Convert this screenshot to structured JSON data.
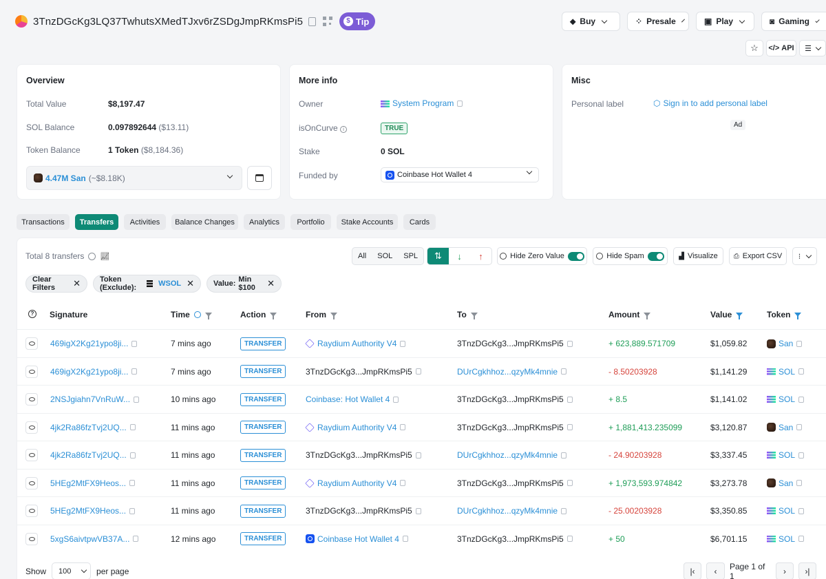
{
  "header": {
    "address": "3TnzDGcKg3LQ37TwhutsXMedTJxv6rZSDgJmpRKmsPi5",
    "tip_label": "Tip",
    "nav": [
      {
        "label": "Buy",
        "icon": "tag-icon"
      },
      {
        "label": "Presale",
        "icon": "presale-icon"
      },
      {
        "label": "Play",
        "icon": "play-icon"
      },
      {
        "label": "Gaming",
        "icon": "gamepad-icon"
      }
    ],
    "api_label": "API"
  },
  "overview": {
    "title": "Overview",
    "rows": [
      {
        "label": "Total Value",
        "value": "$8,197.47",
        "extra": ""
      },
      {
        "label": "SOL Balance",
        "value": "0.097892644",
        "extra": "($13.11)"
      },
      {
        "label": "Token Balance",
        "value": "1 Token",
        "extra": "($8,184.36)"
      }
    ],
    "token_select": {
      "amount": "4.47M San",
      "approx": "(~$8.18K)"
    }
  },
  "more_info": {
    "title": "More info",
    "owner_label": "Owner",
    "owner_value": "System Program",
    "curve_label": "isOnCurve",
    "curve_value": "TRUE",
    "stake_label": "Stake",
    "stake_value": "0 SOL",
    "funded_label": "Funded by",
    "funded_value": "Coinbase Hot Wallet 4"
  },
  "misc": {
    "title": "Misc",
    "personal_label": "Personal label",
    "sign_in_link": "Sign in to add personal label",
    "ad_label": "Ad"
  },
  "tabs": [
    "Transactions",
    "Transfers",
    "Activities",
    "Balance Changes",
    "Analytics",
    "Portfolio",
    "Stake Accounts",
    "Cards"
  ],
  "active_tab": "Transfers",
  "toolbar": {
    "total": "Total 8 transfers",
    "filter_all": "All",
    "filter_sol": "SOL",
    "filter_spl": "SPL",
    "hide_zero": "Hide Zero Value",
    "hide_spam": "Hide Spam",
    "visualize": "Visualize",
    "export": "Export CSV"
  },
  "chips": {
    "clear": "Clear Filters",
    "token_prefix": "Token (Exclude):",
    "token_value": "WSOL",
    "value_prefix": "Value:",
    "value_value": "Min $100"
  },
  "columns": [
    "Signature",
    "Time",
    "Action",
    "From",
    "To",
    "Amount",
    "Value",
    "Token"
  ],
  "rows": [
    {
      "sig": "469igX2Kg21ypo8ji...",
      "time": "7 mins ago",
      "action": "TRANSFER",
      "from": "Raydium Authority V4",
      "from_type": "raydium",
      "to": "3TnzDGcKg3...JmpRKmsPi5",
      "to_link": false,
      "amount": "+ 623,889.571709",
      "sign": "pos",
      "value": "$1,059.82",
      "token": "San"
    },
    {
      "sig": "469igX2Kg21ypo8ji...",
      "time": "7 mins ago",
      "action": "TRANSFER",
      "from": "3TnzDGcKg3...JmpRKmsPi5",
      "from_type": "plain",
      "to": "DUrCgkhhoz...qzyMk4mnie",
      "to_link": true,
      "amount": "- 8.50203928",
      "sign": "neg",
      "value": "$1,141.29",
      "token": "SOL"
    },
    {
      "sig": "2NSJgiahn7VnRuW...",
      "time": "10 mins ago",
      "action": "TRANSFER",
      "from": "Coinbase: Hot Wallet 4",
      "from_type": "link",
      "to": "3TnzDGcKg3...JmpRKmsPi5",
      "to_link": false,
      "amount": "+ 8.5",
      "sign": "pos",
      "value": "$1,141.02",
      "token": "SOL"
    },
    {
      "sig": "4jk2Ra86fzTvj2UQ...",
      "time": "11 mins ago",
      "action": "TRANSFER",
      "from": "Raydium Authority V4",
      "from_type": "raydium",
      "to": "3TnzDGcKg3...JmpRKmsPi5",
      "to_link": false,
      "amount": "+ 1,881,413.235099",
      "sign": "pos",
      "value": "$3,120.87",
      "token": "San"
    },
    {
      "sig": "4jk2Ra86fzTvj2UQ...",
      "time": "11 mins ago",
      "action": "TRANSFER",
      "from": "3TnzDGcKg3...JmpRKmsPi5",
      "from_type": "plain",
      "to": "DUrCgkhhoz...qzyMk4mnie",
      "to_link": true,
      "amount": "- 24.90203928",
      "sign": "neg",
      "value": "$3,337.45",
      "token": "SOL"
    },
    {
      "sig": "5HEg2MtFX9Heos...",
      "time": "11 mins ago",
      "action": "TRANSFER",
      "from": "Raydium Authority V4",
      "from_type": "raydium",
      "to": "3TnzDGcKg3...JmpRKmsPi5",
      "to_link": false,
      "amount": "+ 1,973,593.974842",
      "sign": "pos",
      "value": "$3,273.78",
      "token": "San"
    },
    {
      "sig": "5HEg2MtFX9Heos...",
      "time": "11 mins ago",
      "action": "TRANSFER",
      "from": "3TnzDGcKg3...JmpRKmsPi5",
      "from_type": "plain",
      "to": "DUrCgkhhoz...qzyMk4mnie",
      "to_link": true,
      "amount": "- 25.00203928",
      "sign": "neg",
      "value": "$3,350.85",
      "token": "SOL"
    },
    {
      "sig": "5xgS6aivtpwVB37A...",
      "time": "12 mins ago",
      "action": "TRANSFER",
      "from": "Coinbase Hot Wallet 4",
      "from_type": "coinbase",
      "to": "3TnzDGcKg3...JmpRKmsPi5",
      "to_link": false,
      "amount": "+ 50",
      "sign": "pos",
      "value": "$6,701.15",
      "token": "SOL"
    }
  ],
  "footer": {
    "show_label": "Show",
    "page_size": "100",
    "per_page": "per page",
    "page_info": "Page 1 of 1"
  }
}
